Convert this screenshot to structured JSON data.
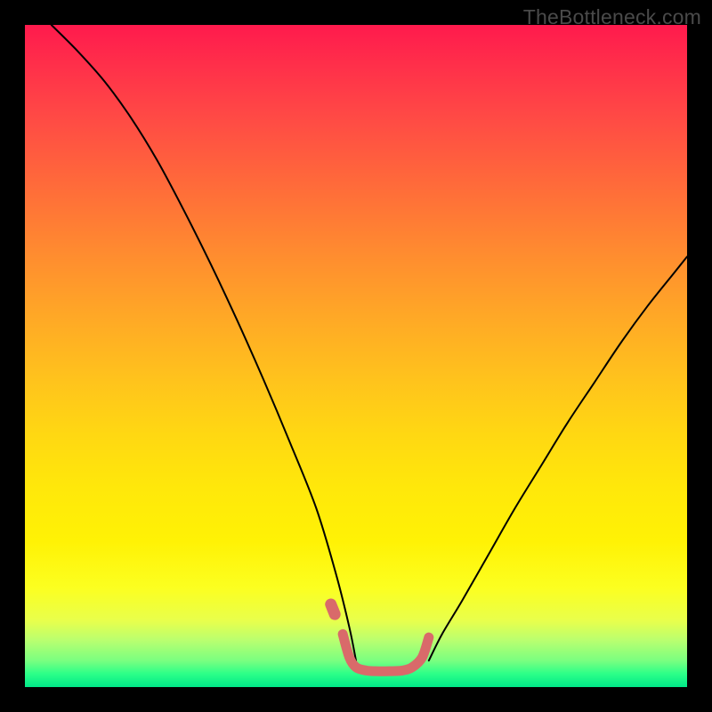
{
  "watermark": "TheBottleneck.com",
  "chart_data": {
    "type": "line",
    "title": "",
    "xlabel": "",
    "ylabel": "",
    "xlim": [
      0,
      100
    ],
    "ylim": [
      0,
      100
    ],
    "series": [
      {
        "name": "left-branch",
        "stroke": "#000000",
        "stroke_width": 2,
        "x": [
          4,
          8,
          12,
          16,
          20,
          24,
          28,
          32,
          36,
          40,
          44,
          47,
          49,
          50
        ],
        "values": [
          100,
          96,
          91.5,
          86,
          79.5,
          72,
          64,
          55.5,
          46.5,
          37,
          27,
          17,
          9,
          4
        ]
      },
      {
        "name": "right-branch",
        "stroke": "#000000",
        "stroke_width": 2,
        "x": [
          61,
          63,
          66,
          70,
          74,
          78,
          82,
          86,
          90,
          94,
          98,
          100
        ],
        "values": [
          4,
          8,
          13,
          20,
          27,
          33.5,
          40,
          46,
          52,
          57.5,
          62.5,
          65
        ]
      },
      {
        "name": "valley-highlight",
        "stroke": "#d96a6a",
        "stroke_width": 11,
        "x": [
          48,
          49,
          50,
          51.5,
          53,
          55,
          57,
          58.5,
          60,
          61
        ],
        "values": [
          8,
          4.5,
          3,
          2.5,
          2.4,
          2.4,
          2.5,
          3,
          4.5,
          7.5
        ]
      },
      {
        "name": "valley-dot",
        "stroke": "#d96a6a",
        "stroke_width": 13,
        "x": [
          46.2,
          46.8
        ],
        "values": [
          12.5,
          11
        ]
      }
    ],
    "gradient_stops": [
      {
        "pos": 0,
        "color": "#ff1a4d"
      },
      {
        "pos": 14,
        "color": "#ff4a45"
      },
      {
        "pos": 34,
        "color": "#ff8a30"
      },
      {
        "pos": 54,
        "color": "#ffc41c"
      },
      {
        "pos": 78,
        "color": "#fff205"
      },
      {
        "pos": 93,
        "color": "#b8ff70"
      },
      {
        "pos": 100,
        "color": "#00e888"
      }
    ]
  }
}
